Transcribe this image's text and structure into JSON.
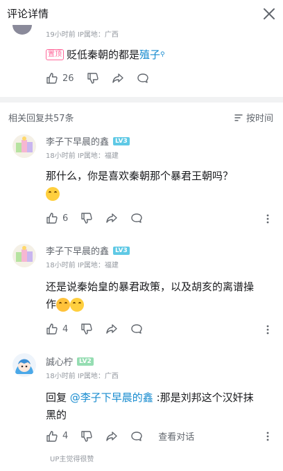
{
  "header": {
    "title": "评论详情"
  },
  "top_comment": {
    "meta": "19小时前  IP属地：广西",
    "pin_label": "置顶",
    "text_plain": "贬低秦朝的都是",
    "text_link": "殖子",
    "likes": "26"
  },
  "replies_header": {
    "count_label": "相关回复共57条",
    "sort_label": "按时间"
  },
  "replies": [
    {
      "username": "李子下早晨的鑫",
      "level": "LV3",
      "meta": "18小时前  IP属地：福建",
      "text": "那什么，你是喜欢秦朝那个暴君王朝吗？",
      "likes": "6"
    },
    {
      "username": "李子下早晨的鑫",
      "level": "LV3",
      "meta": "18小时前  IP属地：福建",
      "text": "还是说秦始皇的暴君政策，以及胡亥的离谱操作",
      "likes": "4"
    },
    {
      "username": "誠心柠",
      "level": "LV2",
      "meta": "18小时前  IP属地：广西",
      "reply_prefix": "回复 ",
      "mention": "@李子下早晨的鑫",
      "text": " :那是刘邦这个汉奸抹黑的",
      "likes": "4",
      "view_convo": "查看对话"
    }
  ],
  "footer": {
    "up_liked": "UP主觉得很赞"
  },
  "colors": {
    "link": "#178bcf",
    "lv3": "#5fc9e5",
    "lv2": "#95ddb2",
    "meta": "#9499a0",
    "divider": "#f1f2f3"
  }
}
